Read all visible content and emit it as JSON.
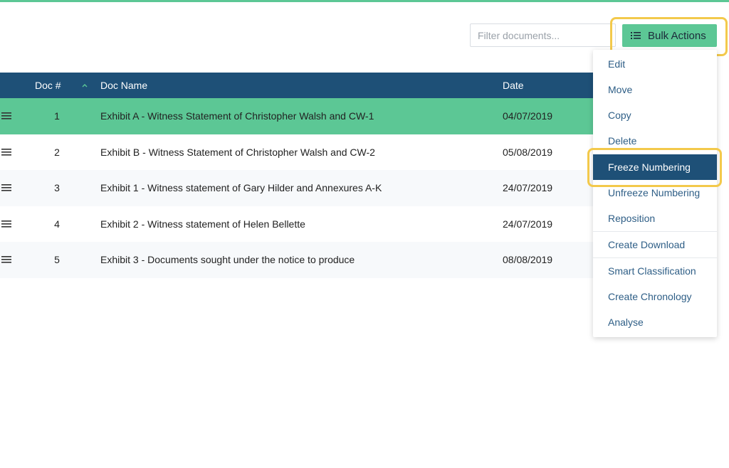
{
  "filter": {
    "placeholder": "Filter documents..."
  },
  "bulk_actions": {
    "label": "Bulk Actions",
    "icon": "list-icon"
  },
  "table": {
    "columns": {
      "doc_num": "Doc #",
      "doc_name": "Doc Name",
      "date": "Date"
    },
    "sort_icon": "chevron-up-icon",
    "rows": [
      {
        "num": "1",
        "name": "Exhibit A - Witness Statement of Christopher Walsh and CW-1",
        "date": "04/07/2019",
        "selected": true
      },
      {
        "num": "2",
        "name": "Exhibit B - Witness Statement of Christopher Walsh and CW-2",
        "date": "05/08/2019",
        "selected": false
      },
      {
        "num": "3",
        "name": "Exhibit 1 - Witness statement of Gary Hilder and Annexures A-K",
        "date": "24/07/2019",
        "selected": false
      },
      {
        "num": "4",
        "name": "Exhibit 2 - Witness statement of Helen Bellette",
        "date": "24/07/2019",
        "selected": false
      },
      {
        "num": "5",
        "name": "Exhibit 3 - Documents sought under the notice to produce",
        "date": "08/08/2019",
        "selected": false
      }
    ]
  },
  "menu": {
    "items": [
      "Edit",
      "Move",
      "Copy",
      "Delete",
      "Freeze Numbering",
      "Unfreeze Numbering",
      "Reposition",
      "Create Download",
      "Smart Classification",
      "Create Chronology",
      "Analyse"
    ],
    "active_item": "Freeze Numbering"
  },
  "colors": {
    "accent_green": "#5cc795",
    "header_navy": "#1e5077",
    "menu_text": "#2e5e86",
    "highlight_yellow": "#f3c94b"
  }
}
